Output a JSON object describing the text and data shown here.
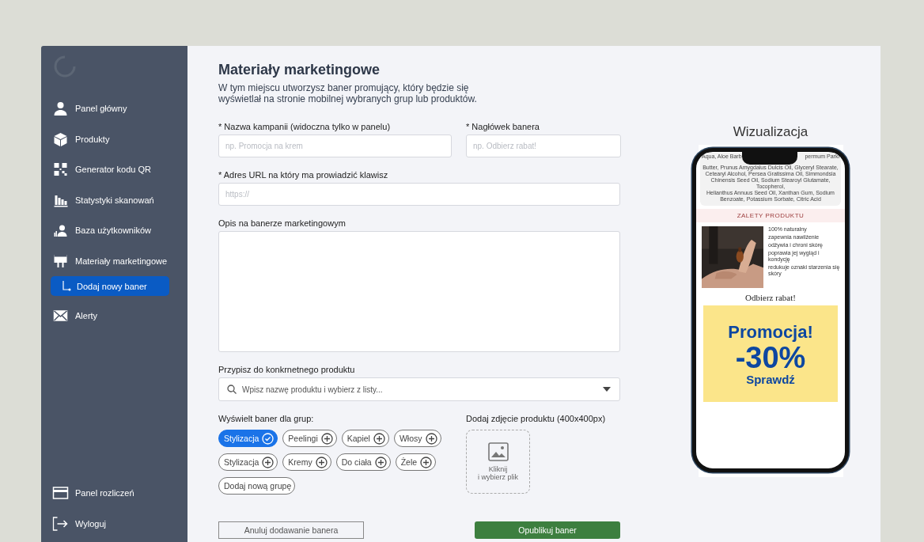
{
  "sidebar": {
    "items": [
      {
        "label": "Panel główny",
        "selected": false
      },
      {
        "label": "Produkty",
        "selected": false
      },
      {
        "label": "Generator kodu QR",
        "selected": false
      },
      {
        "label": "Statystyki skanowań",
        "selected": false
      },
      {
        "label": "Baza użytkowników",
        "selected": false
      },
      {
        "label": "Materiały marketingowe",
        "selected": false,
        "children": [
          {
            "label": "Dodaj nowy baner",
            "selected": true
          }
        ]
      },
      {
        "label": "Alerty",
        "selected": false
      }
    ],
    "bottom_items": [
      {
        "label": "Panel rozliczeń"
      },
      {
        "label": "Wyloguj"
      }
    ]
  },
  "page": {
    "title": "Materiały marketingowe",
    "description": "W tym miejscu utworzysz baner promujący, który będzie się wyświetlał na stronie mobilnej wybranych grup lub produktów."
  },
  "form": {
    "campaign_name": {
      "label": "* Nazwa kampanii (widoczna tylko w panelu)",
      "placeholder": "np. Promocja na krem"
    },
    "banner_header": {
      "label": "* Nagłówek banera",
      "placeholder": "np. Odbierz rabat!"
    },
    "url": {
      "label": "* Adres URL na który ma prowiadzić klawisz",
      "placeholder": "https://"
    },
    "description": {
      "label": "Opis na banerze marketingowym"
    },
    "product": {
      "label": "Przypisz do konkrnetnego produktu",
      "placeholder": "Wpisz nazwę produktu i wybierz z listy..."
    },
    "groups": {
      "label": "Wyświelt baner dla grup:",
      "items": [
        {
          "label": "Stylizacja",
          "selected": true
        },
        {
          "label": "Peelingi",
          "selected": false
        },
        {
          "label": "Kapiel",
          "selected": false
        },
        {
          "label": "Włosy",
          "selected": false
        },
        {
          "label": "Stylizacja",
          "selected": false
        },
        {
          "label": "Kremy",
          "selected": false
        },
        {
          "label": "Do ciała",
          "selected": false
        },
        {
          "label": "Żele",
          "selected": false
        }
      ],
      "add_label": "Dodaj nową grupę"
    },
    "photo": {
      "label": "Dodaj zdjęcie produktu (400x400px)",
      "hint": "Kliknij\ni wybierz plik"
    },
    "cancel": "Anuluj dodawanie banera",
    "publish": "Opublikuj baner"
  },
  "preview": {
    "title": "Wizualizacja",
    "ingredients": [
      "Aqua, Aloe Barb",
      "permum Parki",
      "Butter, Prunus Amygdalus Dulcis Oil, Glyceryl Stearate,",
      "Cetearyl Alcohol, Persea Gratissima Oil, Simmondsia",
      "Chinensis Seed Oil, Sodium Stearoyl Glutamate, Tocopherol,",
      "Helianthus Annuus Seed Oil, Xanthan Gum, Sodium",
      "Benzoate, Potassium Sorbate, Citric Acid"
    ],
    "section": "ZALETY PRODUKTU",
    "benefits": [
      "100% naturalny",
      "zapewnia nawilżenie",
      "odżywia i chroni skórę",
      "poprawia jej wygląd i kondycję",
      "redukuje oznaki starzenia się skóry"
    ],
    "heading": "Odbierz rabat!",
    "promo": {
      "title": "Promocja!",
      "discount": "-30%",
      "cta": "Sprawdź"
    }
  }
}
